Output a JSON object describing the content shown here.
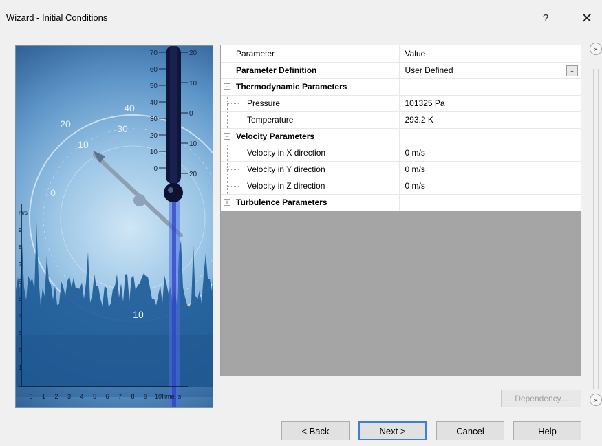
{
  "window": {
    "title": "Wizard - Initial Conditions",
    "help_label": "?",
    "close_label": "✕"
  },
  "side_image": {
    "thermometer_ticks_left": [
      "70",
      "60",
      "50",
      "40",
      "30",
      "20",
      "10",
      "0"
    ],
    "thermometer_ticks_right": [
      "20",
      "10",
      "0",
      "10",
      "20"
    ],
    "gauge_labels": [
      "20",
      "10",
      "0",
      "30",
      "40",
      "10"
    ],
    "bottom_axis": [
      "0",
      "1",
      "2",
      "3",
      "4",
      "5",
      "6",
      "7",
      "8",
      "9",
      "10",
      "Time, s"
    ],
    "left_axis": [
      "m/s",
      "9",
      "8",
      "7",
      "6",
      "5",
      "4",
      "3",
      "2",
      "1",
      "0"
    ]
  },
  "grid": {
    "header": {
      "param": "Parameter",
      "value": "Value"
    },
    "rows": [
      {
        "label": "Parameter Definition",
        "value": "User Defined"
      },
      {
        "label": "Thermodynamic Parameters",
        "value": ""
      },
      {
        "label": "Pressure",
        "value": "101325 Pa"
      },
      {
        "label": "Temperature",
        "value": "293.2 K"
      },
      {
        "label": "Velocity Parameters",
        "value": ""
      },
      {
        "label": "Velocity in X direction",
        "value": "0 m/s"
      },
      {
        "label": "Velocity in Y direction",
        "value": "0 m/s"
      },
      {
        "label": "Velocity in Z direction",
        "value": "0 m/s"
      },
      {
        "label": "Turbulence Parameters",
        "value": ""
      }
    ],
    "expander_expanded": "−",
    "expander_collapsed": "+",
    "dropdown_glyph": "⌄"
  },
  "side_controls": {
    "collapse_glyph": "»"
  },
  "buttons": {
    "dependency": "Dependency...",
    "back": "< Back",
    "next": "Next >",
    "cancel": "Cancel",
    "help": "Help"
  }
}
